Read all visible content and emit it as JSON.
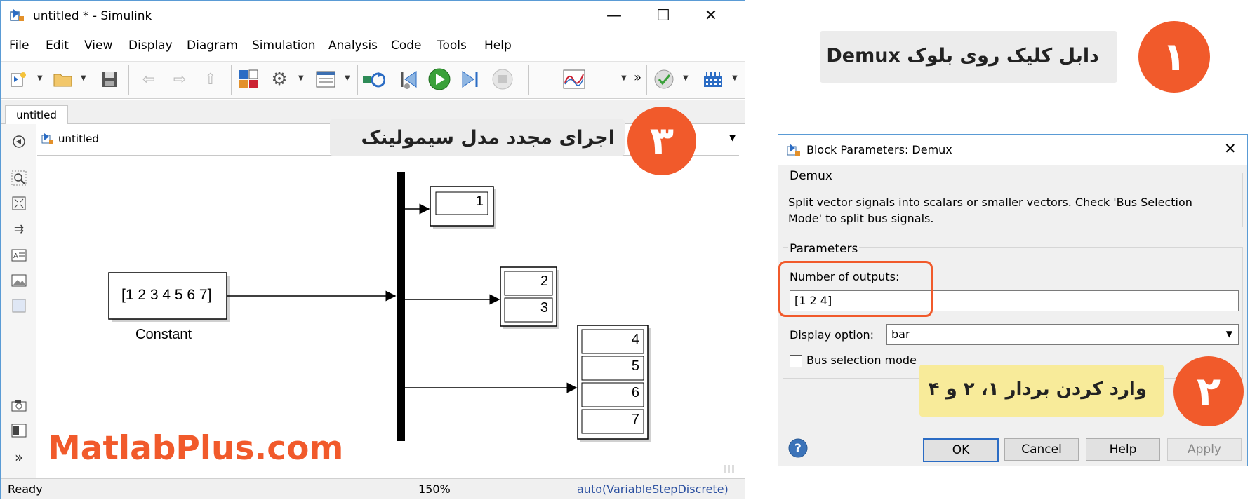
{
  "simulink": {
    "window_title": "untitled * - Simulink",
    "menu": [
      "File",
      "Edit",
      "View",
      "Display",
      "Diagram",
      "Simulation",
      "Analysis",
      "Code",
      "Tools",
      "Help"
    ],
    "tab": "untitled",
    "address": "untitled",
    "toolbar_overflow": "»",
    "left_overflow": "»",
    "constant_value": "[1 2 3 4 5 6 7]",
    "constant_label": "Constant",
    "display1": [
      "1"
    ],
    "display2": [
      "2",
      "3"
    ],
    "display3": [
      "4",
      "5",
      "6",
      "7"
    ],
    "status": {
      "left": "Ready",
      "center": "150%",
      "right": "auto(VariableStepDiscrete)"
    }
  },
  "dialog": {
    "title": "Block Parameters: Demux",
    "group1_label": "Demux",
    "description": "Split vector signals into scalars or smaller vectors. Check 'Bus Selection Mode' to split bus signals.",
    "group2_label": "Parameters",
    "outputs_label": "Number of outputs:",
    "outputs_value": "[1 2 4]",
    "display_option_label": "Display option:",
    "display_option_value": "bar",
    "bus_selection_label": "Bus selection mode",
    "buttons": {
      "ok": "OK",
      "cancel": "Cancel",
      "help": "Help",
      "apply": "Apply"
    }
  },
  "annotations": {
    "step1_number": "۱",
    "step1_text": "دابل کلیک روی بلوک Demux",
    "step2_number": "۲",
    "step2_text": "وارد کردن بردار ۱، ۲ و ۴",
    "step3_number": "۳",
    "step3_text": "اجرای مجدد مدل سیمولینک",
    "watermark": "MatlabPlus.com"
  },
  "colors": {
    "accent_orange": "#f15a2b",
    "note_yellow": "#f8eb9a",
    "note_gray": "#ececec",
    "window_border": "#5a9bd5"
  }
}
